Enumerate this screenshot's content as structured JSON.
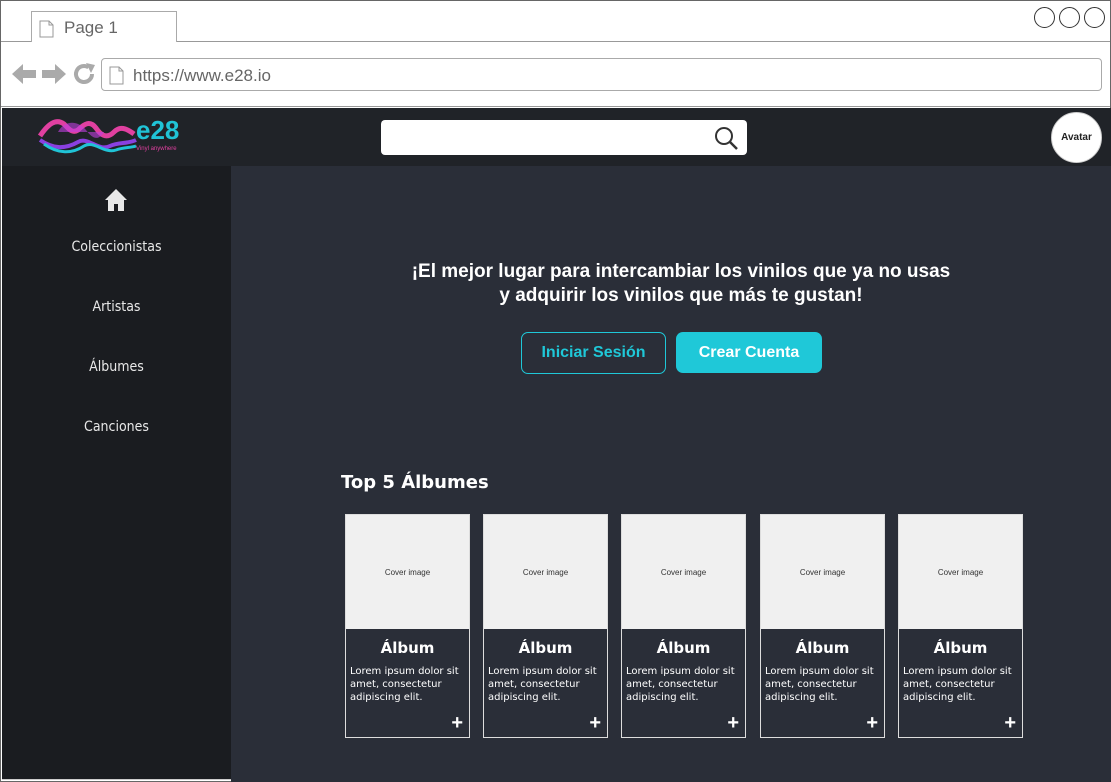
{
  "browser": {
    "tab_title": "Page 1",
    "url": "https://www.e28.io"
  },
  "header": {
    "logo_text": "e28",
    "logo_tagline": "Vinyl anywhere",
    "search_placeholder": "",
    "avatar_label": "Avatar"
  },
  "sidebar": {
    "items": [
      {
        "label": "Coleccionistas"
      },
      {
        "label": "Artistas"
      },
      {
        "label": "Álbumes"
      },
      {
        "label": "Canciones"
      }
    ]
  },
  "hero": {
    "line1": "¡El mejor lugar para intercambiar los vinilos que ya no usas",
    "line2": "y adquirir los vinilos que más te gustan!",
    "login_label": "Iniciar Sesión",
    "signup_label": "Crear Cuenta"
  },
  "top_albums": {
    "title": "Top 5 Álbumes",
    "albums": [
      {
        "cover": "Cover image",
        "title": "Álbum",
        "desc": "Lorem ipsum dolor sit amet, consectetur adipiscing elit.",
        "add": "+"
      },
      {
        "cover": "Cover image",
        "title": "Álbum",
        "desc": "Lorem ipsum dolor sit amet, consectetur adipiscing elit.",
        "add": "+"
      },
      {
        "cover": "Cover image",
        "title": "Álbum",
        "desc": "Lorem ipsum dolor sit amet, consectetur adipiscing elit.",
        "add": "+"
      },
      {
        "cover": "Cover image",
        "title": "Álbum",
        "desc": "Lorem ipsum dolor sit amet, consectetur adipiscing elit.",
        "add": "+"
      },
      {
        "cover": "Cover image",
        "title": "Álbum",
        "desc": "Lorem ipsum dolor sit amet, consectetur adipiscing elit.",
        "add": "+"
      }
    ]
  },
  "colors": {
    "accent": "#1fc8d8",
    "header_bg": "#202328",
    "sidebar_bg": "#1a1c20",
    "main_bg": "#2a2e38"
  }
}
